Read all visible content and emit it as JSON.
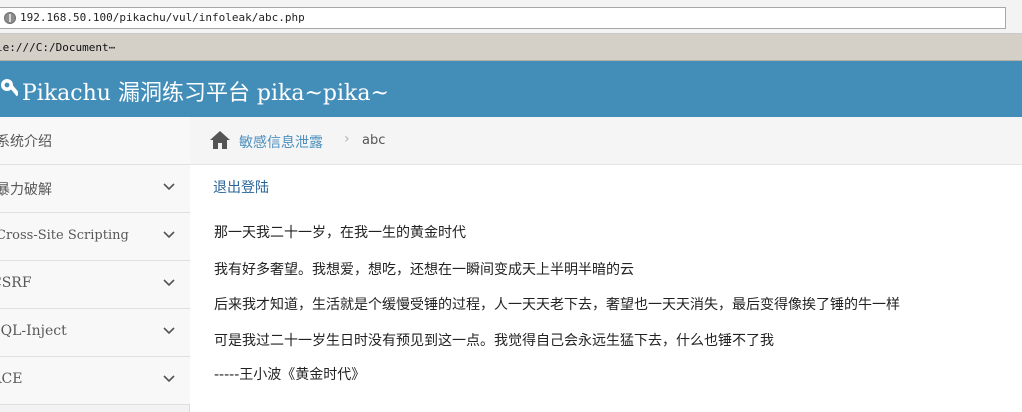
{
  "browser": {
    "url": "192.168.50.100/pikachu/vul/infoleak/abc.php",
    "tab_title": "le:///C:/Document⋯"
  },
  "navbar": {
    "title": "Pikachu 漏洞练习平台 pika~pika~"
  },
  "sidebar": {
    "items": [
      {
        "label": "系统介绍"
      },
      {
        "label": "暴力破解"
      },
      {
        "label": "Cross-Site Scripting"
      },
      {
        "label": "CSRF"
      },
      {
        "label": "SQL-Inject"
      },
      {
        "label": "RCE"
      }
    ]
  },
  "breadcrumb": {
    "parent": "敏感信息泄露",
    "separator": "›",
    "current": "abc"
  },
  "main": {
    "logout_label": "退出登陆",
    "paragraphs": [
      "那一天我二十一岁，在我一生的黄金时代",
      "我有好多奢望。我想爱，想吃，还想在一瞬间变成天上半明半暗的云",
      "后来我才知道，生活就是个缓慢受锤的过程，人一天天老下去，奢望也一天天消失，最后变得像挨了锤的牛一样",
      "可是我过二十一岁生日时没有预见到这一点。我觉得自己会永远生猛下去，什么也锤不了我",
      "-----王小波《黄金时代》"
    ]
  },
  "colors": {
    "navbar_bg": "#438eb9",
    "link": "#4c8fbd"
  },
  "icons": {
    "address": "globe-icon",
    "brand": "wrench-icon",
    "breadcrumb": "home-icon",
    "sidebar_expand": "chevron-down-icon"
  }
}
